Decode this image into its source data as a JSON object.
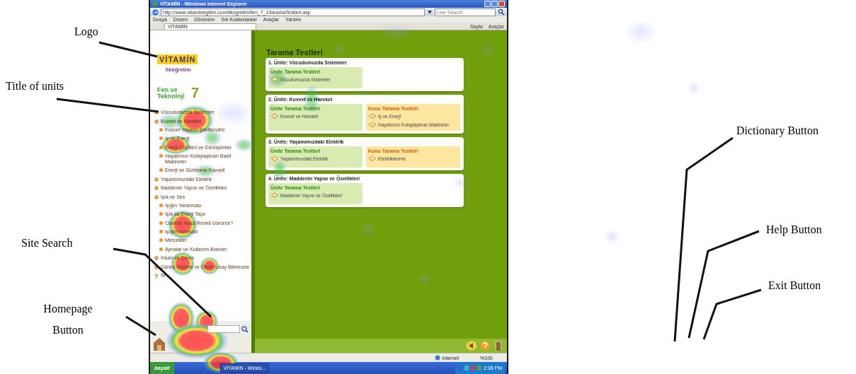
{
  "window": {
    "title": "VİTAMİN - Windows Internet Explorer",
    "address": "http://www.vitaminegitim.com/ilkogretim/fen_7_1/taramaTestleri.asp",
    "search_placeholder": "Live Search"
  },
  "menu": [
    "Dosya",
    "Düzen",
    "Görünüm",
    "Sık Kullanılanlar",
    "Araçlar",
    "Yardım"
  ],
  "tabs": [
    {
      "label": "VİTAMİN",
      "selected": true
    }
  ],
  "toolbar": [
    "Sayfa",
    "Araçlar"
  ],
  "sidebar": {
    "logo": "VİTAMİN",
    "subtitle": "İlköğretim",
    "course": "Fen ve Teknoloji",
    "grade": "7",
    "items": [
      {
        "label": "Vücudumuzda Sistemler",
        "kind": "unit"
      },
      {
        "label": "Kuvvet ve Hareket",
        "kind": "unit",
        "children": [
          {
            "label": "Kuvvet Yaşamı Şekillendirir",
            "kind": "topic"
          },
          {
            "label": "İş ve Enerji",
            "kind": "topic"
          },
          {
            "label": "Enerji Çeşitleri ve Dönüşümler",
            "kind": "topic"
          },
          {
            "label": "Hayatımızı Kolaylaştıran Basit Makineler",
            "kind": "topic"
          },
          {
            "label": "Enerji ve Sürtünme Kuvveti",
            "kind": "topic"
          }
        ]
      },
      {
        "label": "Yaşamımızdaki Elektrik",
        "kind": "unit"
      },
      {
        "label": "Maddenin Yapısı ve Özellikleri",
        "kind": "unit"
      },
      {
        "label": "Işık ve Ses",
        "kind": "unit",
        "children": [
          {
            "label": "Işığın Yansıması",
            "kind": "topic"
          },
          {
            "label": "Işık da Enerji Taşır",
            "kind": "topic"
          },
          {
            "label": "Cisimler Nasıl Renkli Görünür?",
            "kind": "topic"
          },
          {
            "label": "Işığın Kırılması",
            "kind": "topic"
          },
          {
            "label": "Mercekler",
            "kind": "topic"
          },
          {
            "label": "Aynalar ve Kullanım Alanları",
            "kind": "topic"
          }
        ]
      },
      {
        "label": "İnsan ve Çevre",
        "kind": "unit"
      },
      {
        "label": "Güneş Sistemi ve Ötesi: Uzay Bilmecesi",
        "kind": "unit"
      },
      {
        "label": "Te",
        "kind": "test",
        "icon": "?"
      }
    ]
  },
  "content": {
    "title": "Tarama Testleri",
    "units": [
      {
        "title": "1. Ünite: Vücudumuzda Sistemler",
        "boxes": [
          {
            "kind": "unit",
            "header": "Ünite Tarama Testleri",
            "items": [
              "Vücudumuzda Sistemler"
            ]
          }
        ]
      },
      {
        "title": "2. Ünite: Kuvvet ve Hareket",
        "boxes": [
          {
            "kind": "unit",
            "header": "Ünite Tarama Testleri",
            "items": [
              "Kuvvet ve Hareket"
            ]
          },
          {
            "kind": "topic",
            "header": "Konu Tarama Testleri",
            "items": [
              "İş ve Enerji",
              "Hayatımızı Kolaylaştıran Makineler"
            ]
          }
        ]
      },
      {
        "title": "3. Ünite: Yaşamımızdaki Elektrik",
        "boxes": [
          {
            "kind": "unit",
            "header": "Ünite Tarama Testleri",
            "items": [
              "Yaşamımızdaki Elektrik"
            ]
          },
          {
            "kind": "topic",
            "header": "Konu Tarama Testleri",
            "items": [
              "Elektriklenme"
            ]
          }
        ]
      },
      {
        "title": "4. Ünite: Maddenin Yapısı ve Özellikleri",
        "boxes": [
          {
            "kind": "unit",
            "header": "Ünite Tarama Testleri",
            "items": [
              "Maddenin Yapısı ve Özellikleri"
            ]
          }
        ]
      }
    ]
  },
  "status_bar": {
    "zone": "Internet",
    "zoom": "%100"
  },
  "taskbar": {
    "start": "başlat",
    "windows": [
      "VİTAMİN - Windo..."
    ],
    "clock": "2:38 PM"
  },
  "annotations": [
    {
      "label": "Logo"
    },
    {
      "label": "Title of units"
    },
    {
      "label": "Site Search"
    },
    {
      "label": "Homepage Button"
    },
    {
      "label": "Dictionary Button"
    },
    {
      "label": "Help Button"
    },
    {
      "label": "Exit Button"
    }
  ]
}
